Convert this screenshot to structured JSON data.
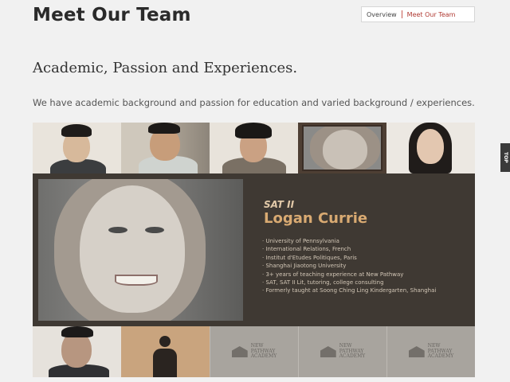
{
  "header": {
    "title": "Meet Our Team",
    "nav": [
      {
        "label": "Overview",
        "active": false
      },
      {
        "label": "Meet Our Team",
        "active": true
      }
    ]
  },
  "section": {
    "heading": "Academic, Passion and Experiences.",
    "description": "We have academic background and passion for education and varied background / experiences."
  },
  "side_tab": {
    "label": "TOP"
  },
  "team": {
    "selected_index": 3,
    "thumbnails": [
      "team-member-1",
      "team-member-2",
      "team-member-3",
      "team-member-4",
      "team-member-5"
    ]
  },
  "profile": {
    "subject": "SAT II",
    "name": "Logan Currie",
    "details": [
      "· University of Pennsylvania",
      "· International Relations, French",
      "· Institut d'Etudes Politiques, Paris",
      "· Shanghai Jiaotong University",
      "· 3+ years of teaching experience at New Pathway",
      "· SAT, SAT II Lit, tutoring, college consulting",
      "· Formerly taught at Soong Ching Ling Kindergarten, Shanghai"
    ]
  },
  "logo": {
    "line1": "NEW",
    "line2": "PATHWAY",
    "line3": "ACADEMY"
  },
  "colors": {
    "accent": "#b03a33",
    "profile_bg": "#3f3933",
    "name": "#d9aa72",
    "placeholder": "#c9a47e",
    "logo_tile": "#a8a49e"
  }
}
